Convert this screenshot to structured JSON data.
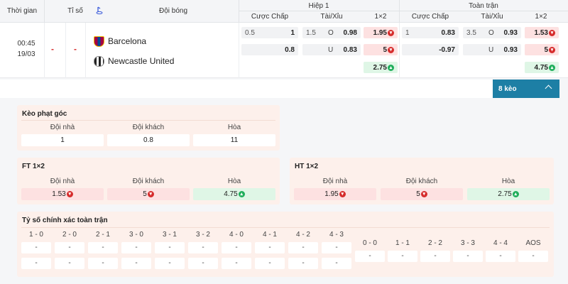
{
  "header": {
    "time": "Thời gian",
    "score": "Tỉ số",
    "match": "Đội bóng",
    "half": "Hiệp 1",
    "full": "Toàn trận",
    "handicap": "Cược Chấp",
    "overunder": "Tài/Xỉu",
    "x12": "1×2"
  },
  "match": {
    "time": "00:45",
    "date": "19/03",
    "score_home": "-",
    "score_away": "-",
    "home": "Barcelona",
    "away": "Newcastle United",
    "h1": {
      "hdp_line": "0.5",
      "hdp_home": "1",
      "hdp_away": "0.8",
      "ou_line": "1.5",
      "ou_o": "O",
      "ou_over": "0.98",
      "ou_u": "U",
      "ou_under": "0.83",
      "x12_1": "1.95",
      "x12_2": "5",
      "x12_x": "2.75"
    },
    "ft": {
      "hdp_home": "0.83",
      "hdp_line": "1",
      "hdp_away": "-0.97",
      "ou_line": "3.5",
      "ou_o": "O",
      "ou_over": "0.93",
      "ou_u": "U",
      "ou_under": "0.93",
      "x12_1": "1.53",
      "x12_2": "5",
      "x12_x": "4.75"
    }
  },
  "more_label": "8 kèo",
  "corner": {
    "title": "Kèo phạt góc",
    "cols": [
      "Đội nhà",
      "Đội khách",
      "Hòa"
    ],
    "vals": [
      "1",
      "0.8",
      "11"
    ]
  },
  "ft12": {
    "title": "FT 1×2",
    "cols": [
      "Đội nhà",
      "Đội khách",
      "Hòa"
    ],
    "vals": [
      "1.53",
      "5",
      "4.75"
    ]
  },
  "ht12": {
    "title": "HT 1×2",
    "cols": [
      "Đội nhà",
      "Đội khách",
      "Hòa"
    ],
    "vals": [
      "1.95",
      "5",
      "2.75"
    ]
  },
  "exact": {
    "title": "Tỷ số chính xác toàn trận",
    "home_scores": [
      "1 - 0",
      "2 - 0",
      "2 - 1",
      "3 - 0",
      "3 - 1",
      "3 - 2",
      "4 - 0",
      "4 - 1",
      "4 - 2",
      "4 - 3"
    ],
    "draw_scores": [
      "0 - 0",
      "1 - 1",
      "2 - 2",
      "3 - 3",
      "4 - 4",
      "AOS"
    ],
    "empty": "-"
  },
  "colors": {
    "accent": "#1d7fa5",
    "down": "#d62c2c",
    "up": "#1fae5b",
    "panel": "#fdf0eb"
  }
}
